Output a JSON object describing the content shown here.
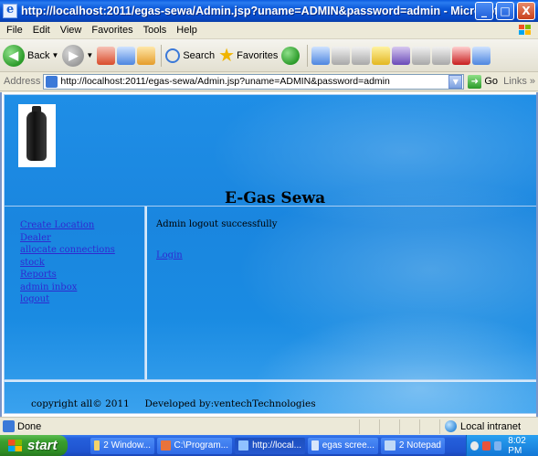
{
  "window": {
    "title": "http://localhost:2011/egas-sewa/Admin.jsp?uname=ADMIN&password=admin - Microsoft Internet Explorer",
    "minimize": "_",
    "maximize": "□",
    "close": "X"
  },
  "menu": [
    "File",
    "Edit",
    "View",
    "Favorites",
    "Tools",
    "Help"
  ],
  "toolbar": {
    "back": "Back",
    "search": "Search",
    "favorites": "Favorites"
  },
  "address": {
    "label": "Address",
    "url": "http://localhost:2011/egas-sewa/Admin.jsp?uname=ADMIN&password=admin",
    "go": "Go",
    "links": "Links »"
  },
  "page": {
    "title": "E-Gas Sewa",
    "nav": [
      "Create Location",
      "Dealer",
      "allocate connections",
      "stock",
      "Reports",
      "admin inbox",
      "logout"
    ],
    "message": "Admin logout successfully",
    "login_link": "Login",
    "footer": "copyright all© 2011     Developed by:ventechTechnologies"
  },
  "status": {
    "text": "Done",
    "zone": "Local intranet"
  },
  "taskbar": {
    "start": "start",
    "tasks": [
      "2 Window...",
      "C:\\Program...",
      "http://local...",
      "egas scree...",
      "2 Notepad"
    ],
    "clock": "8:02 PM"
  },
  "colors": {
    "title_bar": "#0b58d8",
    "page_background": "#1a86df",
    "link": "#2f2ad0",
    "start_button": "#3a9f2f",
    "taskbar": "#1f53cf"
  }
}
